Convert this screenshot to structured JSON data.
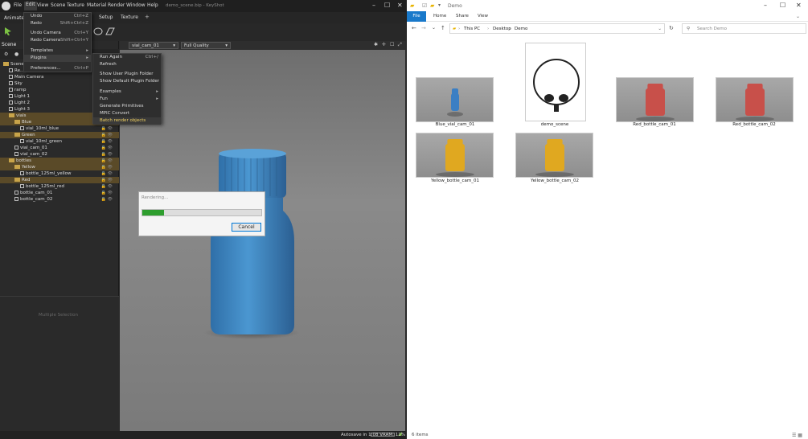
{
  "keyshot": {
    "title": "demo_scene.bip - KeyShot",
    "menu": [
      "File",
      "Edit",
      "View",
      "Scene",
      "Texture",
      "Material",
      "Render",
      "Window",
      "Help"
    ],
    "toolbar_tabs": {
      "animate": "Animate",
      "setup": "Setup",
      "texture": "Texture",
      "plus": "+"
    },
    "scene_tab": "Scene",
    "tree": [
      {
        "label": "Scene",
        "depth": 0,
        "type": "folder"
      },
      {
        "label": "Re...",
        "depth": 1,
        "type": "item"
      },
      {
        "label": "Main Camera",
        "depth": 1,
        "type": "item"
      },
      {
        "label": "Sky",
        "depth": 1,
        "type": "item"
      },
      {
        "label": "ramp",
        "depth": 1,
        "type": "item"
      },
      {
        "label": "Light 1",
        "depth": 1,
        "type": "item"
      },
      {
        "label": "Light 2",
        "depth": 1,
        "type": "item"
      },
      {
        "label": "Light 3",
        "depth": 1,
        "type": "item"
      },
      {
        "label": "vials",
        "depth": 1,
        "type": "folder",
        "selected": true
      },
      {
        "label": "Blue",
        "depth": 2,
        "type": "folder",
        "selected": true
      },
      {
        "label": "vial_10ml_blue",
        "depth": 3,
        "type": "item"
      },
      {
        "label": "Green",
        "depth": 2,
        "type": "folder",
        "selected": true
      },
      {
        "label": "vial_10ml_green",
        "depth": 3,
        "type": "item"
      },
      {
        "label": "vial_cam_01",
        "depth": 2,
        "type": "item"
      },
      {
        "label": "vial_cam_02",
        "depth": 2,
        "type": "item"
      },
      {
        "label": "bottles",
        "depth": 1,
        "type": "folder",
        "selected": true
      },
      {
        "label": "Yellow",
        "depth": 2,
        "type": "folder",
        "selected": true
      },
      {
        "label": "bottle_125ml_yellow",
        "depth": 3,
        "type": "item"
      },
      {
        "label": "Red",
        "depth": 2,
        "type": "folder",
        "selected": true
      },
      {
        "label": "bottle_125ml_red",
        "depth": 3,
        "type": "item"
      },
      {
        "label": "bottle_cam_01",
        "depth": 2,
        "type": "item"
      },
      {
        "label": "bottle_cam_02",
        "depth": 2,
        "type": "item"
      }
    ],
    "multi_selection": "Multiple Selection",
    "camera": "vial_cam_01",
    "quality": "Full Quality",
    "edit_menu": [
      {
        "label": "Undo",
        "shortcut": "Ctrl+Z"
      },
      {
        "label": "Redo",
        "shortcut": "Shift+Ctrl+Z"
      },
      {
        "label": "Undo Camera",
        "shortcut": "Ctrl+Y"
      },
      {
        "label": "Redo Camera",
        "shortcut": "Shift+Ctrl+Y"
      },
      {
        "label": "Templates",
        "shortcut": "▸"
      },
      {
        "label": "Plugins",
        "shortcut": "▸"
      },
      {
        "label": "Preferences...",
        "shortcut": "Ctrl+P"
      }
    ],
    "plugins_menu": [
      {
        "label": "Run Again",
        "shortcut": "Ctrl+/"
      },
      {
        "label": "Refresh",
        "shortcut": ""
      },
      {
        "label": "Show User Plugin Folder",
        "shortcut": ""
      },
      {
        "label": "Show Default Plugin Folder",
        "shortcut": ""
      },
      {
        "label": "Examples",
        "shortcut": "▸"
      },
      {
        "label": "Fun",
        "shortcut": "▸"
      },
      {
        "label": "Generate Primitives",
        "shortcut": ""
      },
      {
        "label": "MPIC Convert",
        "shortcut": ""
      },
      {
        "label": "Batch render objects",
        "shortcut": ""
      }
    ],
    "render_dialog": {
      "title": "Rendering...",
      "progress": 0.18,
      "cancel": "Cancel"
    },
    "status": "Autosave in 1:08   VRAM: 11%",
    "accent_color": "#2e9e2e"
  },
  "explorer": {
    "title": "Demo",
    "ribbon": {
      "file": "File",
      "home": "Home",
      "share": "Share",
      "view": "View"
    },
    "address": [
      "This PC",
      "Desktop",
      "Demo"
    ],
    "search_placeholder": "Search Demo",
    "files": [
      {
        "name": "Blue_vial_cam_01",
        "kind": "image",
        "color": "#3b7fc4"
      },
      {
        "name": "demo_scene",
        "kind": "document",
        "color": "#ffffff"
      },
      {
        "name": "Red_bottle_cam_01",
        "kind": "image",
        "color": "#c8504a"
      },
      {
        "name": "Red_bottle_cam_02",
        "kind": "image",
        "color": "#c8504a"
      },
      {
        "name": "Yellow_bottle_cam_01",
        "kind": "image",
        "color": "#e0a820"
      },
      {
        "name": "Yellow_bottle_cam_02",
        "kind": "image",
        "color": "#e0a820"
      }
    ],
    "item_count": "6 items"
  }
}
